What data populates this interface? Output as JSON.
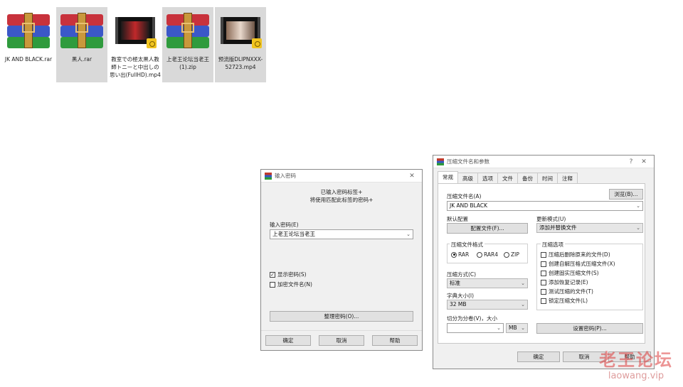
{
  "desktop": {
    "files": [
      {
        "name": "JK AND BLACK.rar",
        "label": "JK AND BLACK.rar",
        "type": "rar"
      },
      {
        "name": "黑人.rar",
        "label": "黑人.rar",
        "type": "rar"
      },
      {
        "name": "教室での極太黒人教師トニーと中出しの思い出(FullHD).mp4",
        "label": "教室での極太黒人教師トニーと中出しの思い出(FullHD).mp4",
        "type": "mp4"
      },
      {
        "name": "上老王论坛当老王 (1).zip",
        "label": "上老王论坛当老王 (1).zip",
        "type": "zip"
      },
      {
        "name": "预流版DLIPNXXX-52723.mp4",
        "label": "预流版DLIPNXXX-52723.mp4",
        "type": "mp4"
      }
    ]
  },
  "password_dialog": {
    "title": "输入密码",
    "message_line1": "已输入密码标签+",
    "message_line2": "将使用匹配此标签的密码+",
    "input_label": "输入密码(E)",
    "input_value": "上老王论坛当老王",
    "show_password_label": "显示密码(S)",
    "show_password_checked": true,
    "encrypt_names_label": "加密文件名(N)",
    "encrypt_names_checked": false,
    "organize_button": "整理密码(O)...",
    "ok_button": "确定",
    "cancel_button": "取消",
    "help_button": "帮助"
  },
  "archive_dialog": {
    "title": "压缩文件名和参数",
    "help_glyph": "?",
    "tabs": [
      "常规",
      "高级",
      "选项",
      "文件",
      "备份",
      "时间",
      "注释"
    ],
    "active_tab": "常规",
    "archive_name_label": "压缩文件名(A)",
    "browse_button": "浏览(B)...",
    "archive_name_value": "JK AND BLACK",
    "default_config_label": "默认配置",
    "config_button": "配置文件(F)...",
    "update_mode_label": "更新模式(U)",
    "update_mode_value": "添加并替换文件",
    "format_group_label": "压缩文件格式",
    "formats": [
      {
        "label": "RAR",
        "selected": true
      },
      {
        "label": "RAR4",
        "selected": false
      },
      {
        "label": "ZIP",
        "selected": false
      }
    ],
    "method_label": "压缩方式(C)",
    "method_value": "标准",
    "dict_label": "字典大小(I)",
    "dict_value": "32 MB",
    "split_label": "切分为分卷(V)，大小",
    "split_value": "",
    "split_unit": "MB",
    "options_group_label": "压缩选项",
    "options": [
      {
        "label": "压缩后删除原来的文件(D)",
        "checked": false
      },
      {
        "label": "创建自解压格式压缩文件(X)",
        "checked": false
      },
      {
        "label": "创建固实压缩文件(S)",
        "checked": false
      },
      {
        "label": "添加恢复记录(E)",
        "checked": false
      },
      {
        "label": "测试压缩的文件(T)",
        "checked": false
      },
      {
        "label": "锁定压缩文件(L)",
        "checked": false
      }
    ],
    "set_password_button": "设置密码(P)...",
    "ok_button": "确定",
    "cancel_button": "取消",
    "help_button": "帮助"
  },
  "watermark": {
    "line1": "老王论坛",
    "line2": "laowang.vip"
  }
}
